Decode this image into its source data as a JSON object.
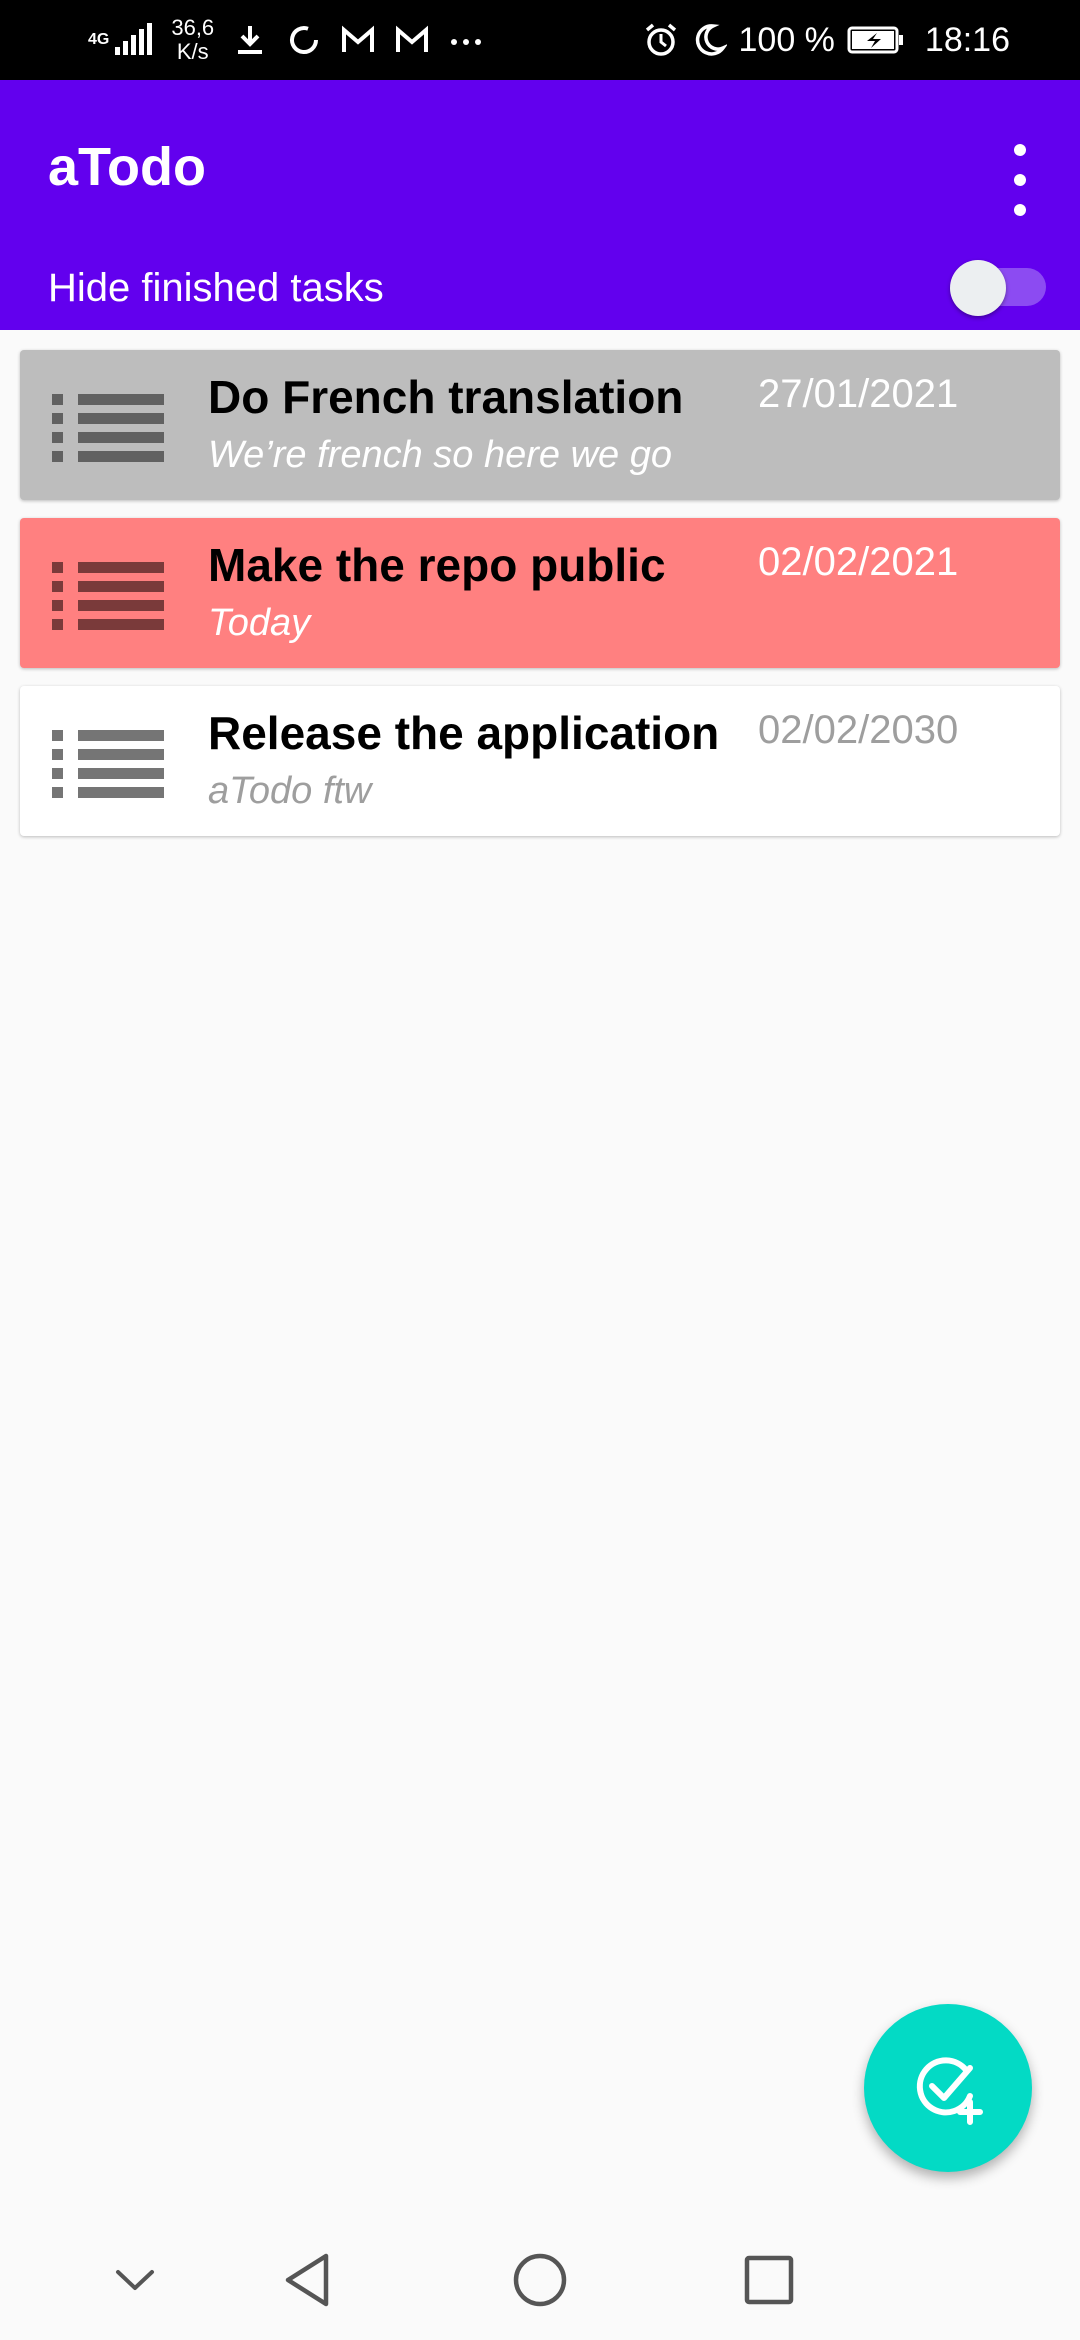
{
  "status_bar": {
    "network": "4G",
    "speed_value": "36,6",
    "speed_unit": "K/s",
    "battery": "100 %",
    "time": "18:16"
  },
  "app_bar": {
    "title": "aTodo",
    "hide_finished_label": "Hide finished tasks",
    "hide_finished_enabled": false,
    "color": "#6200ee"
  },
  "tasks": [
    {
      "title": "Do French translation",
      "description": "We’re french so here we go",
      "date": "27/01/2021",
      "state": "finished",
      "background": "#bdbdbd"
    },
    {
      "title": "Make the repo public",
      "description": "Today",
      "date": "02/02/2021",
      "state": "due-today",
      "background": "#ff8080"
    },
    {
      "title": "Release the application",
      "description": "aTodo ftw",
      "date": "02/02/2030",
      "state": "upcoming",
      "background": "#ffffff"
    }
  ],
  "fab": {
    "icon": "add-task-icon",
    "color": "#03dac5"
  },
  "nav_bar": {
    "icons": [
      "chevron-down-icon",
      "back-icon",
      "home-icon",
      "recents-icon"
    ]
  }
}
